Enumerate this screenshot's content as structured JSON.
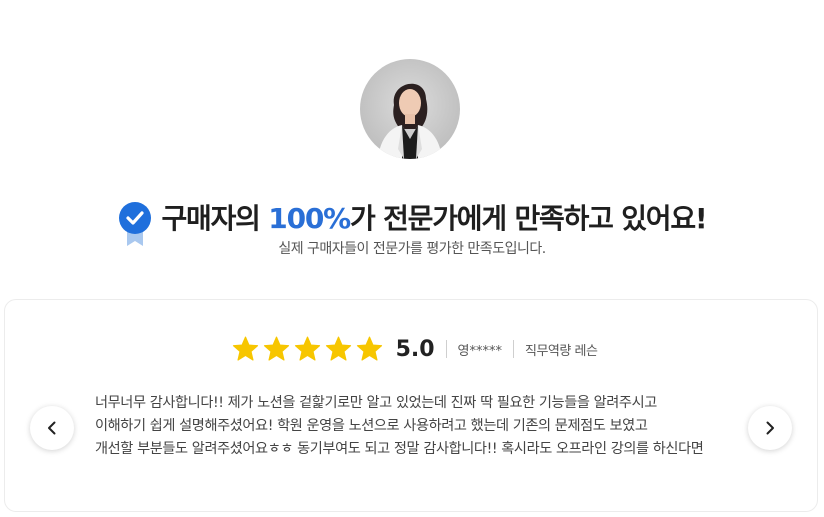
{
  "header": {
    "headline_pre": "구매자의 ",
    "headline_highlight": "100%",
    "headline_post": "가 전문가에게 만족하고 있어요!",
    "subtitle": "실제 구매자들이 전문가를 평가한 만족도입니다.",
    "highlight_color": "#2a6fd6"
  },
  "review": {
    "stars": 5,
    "score": "5.0",
    "reviewer": "영*****",
    "category": "직무역량 레슨",
    "lines": [
      "너무너무 감사합니다!! 제가 노션을 겉핥기로만 알고 있었는데 진짜 딱 필요한 기능들을 알려주시고",
      "이해하기 쉽게 설명해주셨어요! 학원 운영을 노션으로 사용하려고 했는데 기존의 문제점도 보였고",
      "개선할 부분들도 알려주셨어요ㅎㅎ 동기부여도 되고 정말 감사합니다!! 혹시라도 오프라인 강의를 하신다면"
    ],
    "star_color": "#f7c600"
  },
  "icons": {
    "badge": "verified-badge-icon",
    "prev": "chevron-left-icon",
    "next": "chevron-right-icon"
  }
}
